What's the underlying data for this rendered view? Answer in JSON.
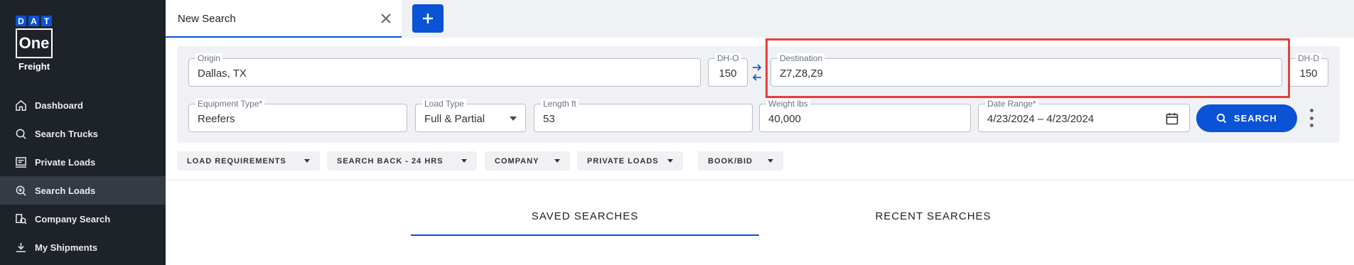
{
  "brand": {
    "dat": [
      "D",
      "A",
      "T"
    ],
    "one": "One",
    "freight": "Freight"
  },
  "sidebar": {
    "items": [
      {
        "label": "Dashboard",
        "icon": "home-icon"
      },
      {
        "label": "Search Trucks",
        "icon": "search-icon"
      },
      {
        "label": "Private Loads",
        "icon": "private-loads-icon"
      },
      {
        "label": "Search Loads",
        "icon": "search-loads-icon",
        "active": true
      },
      {
        "label": "Company Search",
        "icon": "company-search-icon"
      },
      {
        "label": "My Shipments",
        "icon": "shipments-icon"
      }
    ]
  },
  "tabs": {
    "current": "New Search"
  },
  "form": {
    "origin": {
      "label": "Origin",
      "value": "Dallas, TX"
    },
    "dh_o": {
      "label": "DH-O",
      "value": "150"
    },
    "destination": {
      "label": "Destination",
      "value": "Z7,Z8,Z9"
    },
    "dh_d": {
      "label": "DH-D",
      "value": "150"
    },
    "equipment": {
      "label": "Equipment Type*",
      "value": "Reefers"
    },
    "load_type": {
      "label": "Load Type",
      "value": "Full & Partial"
    },
    "length": {
      "label": "Length ft",
      "value": "53"
    },
    "weight": {
      "label": "Weight lbs",
      "value": "40,000"
    },
    "date_range": {
      "label": "Date Range*",
      "value": "4/23/2024 – 4/23/2024"
    },
    "search_label": "SEARCH"
  },
  "filters": [
    "LOAD REQUIREMENTS",
    "SEARCH BACK - 24 HRS",
    "COMPANY",
    "PRIVATE LOADS",
    "BOOK/BID"
  ],
  "searches": {
    "saved": "SAVED SEARCHES",
    "recent": "RECENT SEARCHES"
  },
  "colors": {
    "accent": "#0a52d6",
    "sidebar": "#1e2329",
    "highlight": "#e53e3e"
  }
}
